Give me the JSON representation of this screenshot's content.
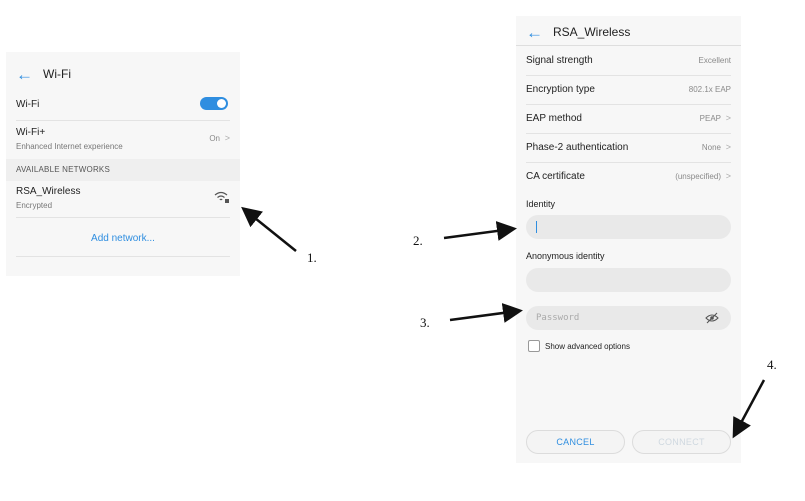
{
  "wifi_screen": {
    "title": "Wi-Fi",
    "wifi_label": "Wi-Fi",
    "wifi_plus_label": "Wi-Fi+",
    "wifi_plus_sub": "Enhanced Internet experience",
    "wifi_plus_value": "On",
    "section_header": "AVAILABLE NETWORKS",
    "network_name": "RSA_Wireless",
    "network_status": "Encrypted",
    "add_network": "Add network..."
  },
  "network_screen": {
    "title": "RSA_Wireless",
    "rows": [
      {
        "label": "Signal strength",
        "value": "Excellent"
      },
      {
        "label": "Encryption type",
        "value": "802.1x EAP"
      },
      {
        "label": "EAP method",
        "value": "PEAP"
      },
      {
        "label": "Phase-2 authentication",
        "value": "None"
      },
      {
        "label": "CA certificate",
        "value": "(unspecified)"
      }
    ],
    "identity_label": "Identity",
    "anonymous_identity_label": "Anonymous identity",
    "password_placeholder": "Password",
    "show_advanced": "Show advanced options",
    "cancel": "CANCEL",
    "connect": "CONNECT"
  },
  "callouts": [
    "1.",
    "2.",
    "3.",
    "4."
  ],
  "colors": {
    "accent": "#2f8ee0",
    "disabled_text": "#cfd8e0"
  }
}
